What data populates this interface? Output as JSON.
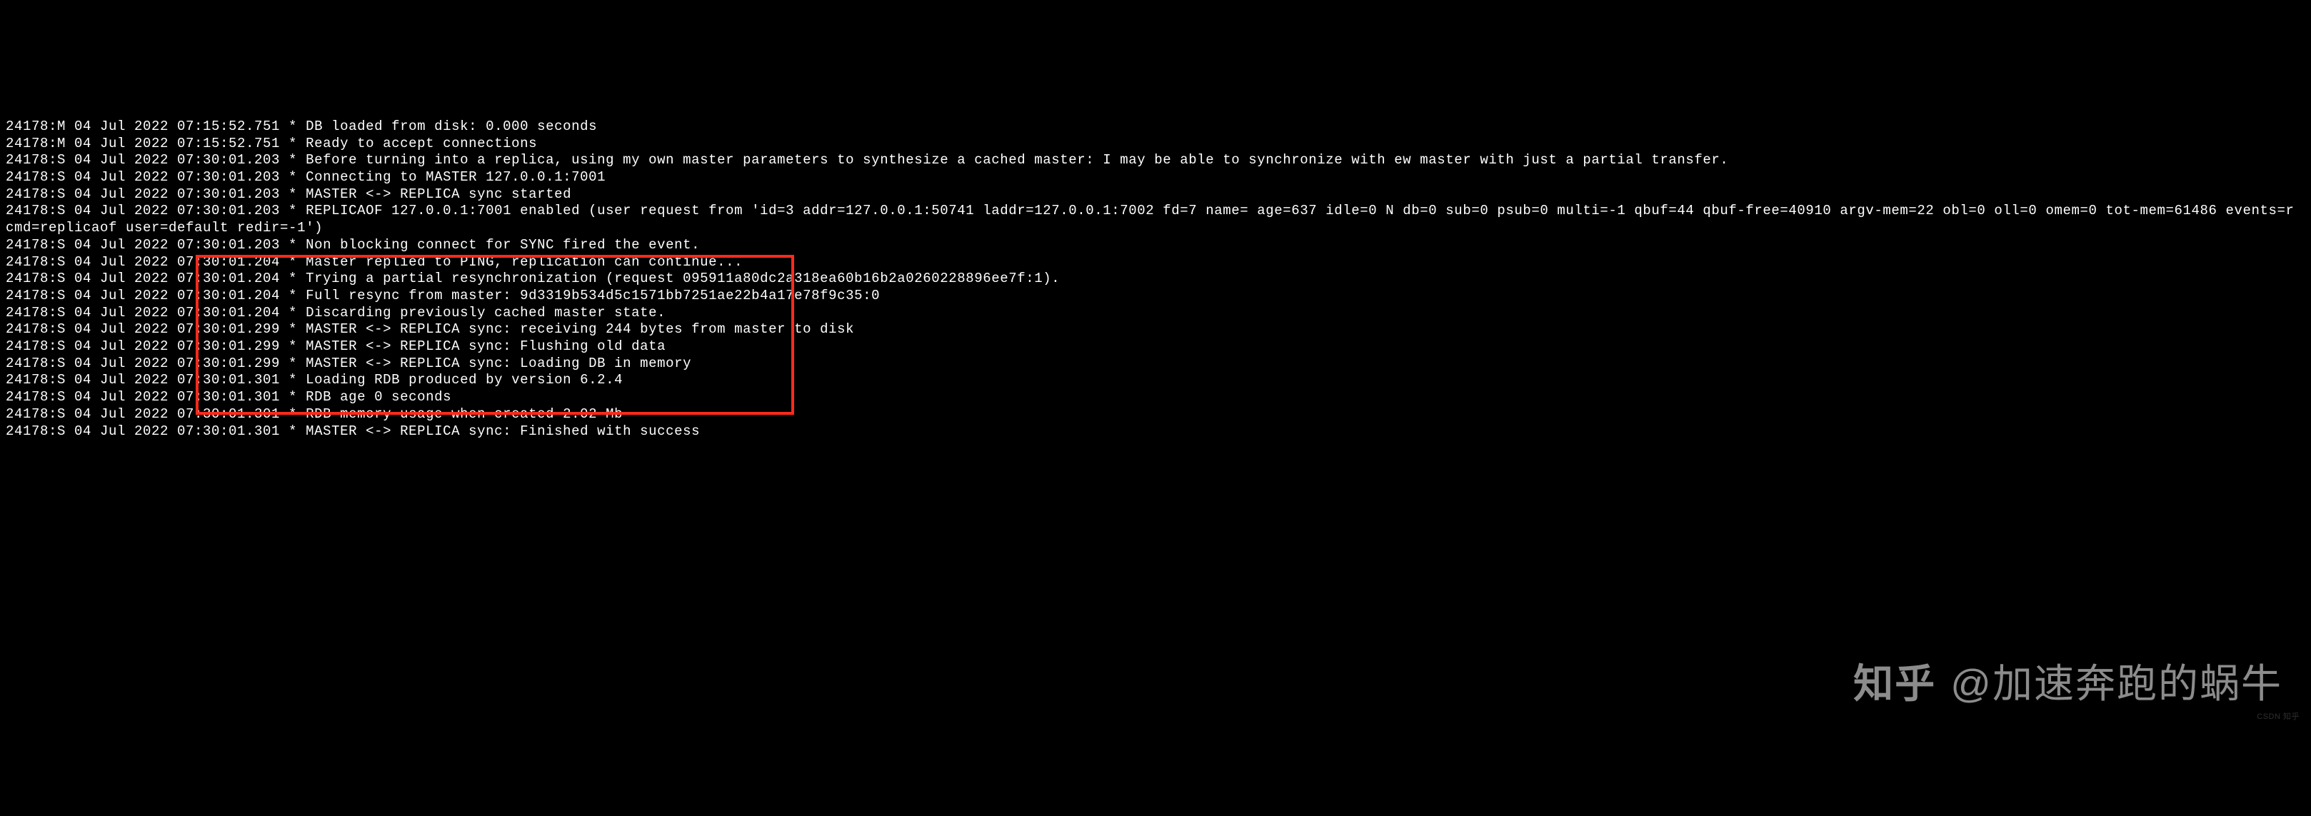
{
  "lines": [
    "24178:M 04 Jul 2022 07:15:52.751 * DB loaded from disk: 0.000 seconds",
    "24178:M 04 Jul 2022 07:15:52.751 * Ready to accept connections",
    "24178:S 04 Jul 2022 07:30:01.203 * Before turning into a replica, using my own master parameters to synthesize a cached master: I may be able to synchronize with ew master with just a partial transfer.",
    "24178:S 04 Jul 2022 07:30:01.203 * Connecting to MASTER 127.0.0.1:7001",
    "24178:S 04 Jul 2022 07:30:01.203 * MASTER <-> REPLICA sync started",
    "24178:S 04 Jul 2022 07:30:01.203 * REPLICAOF 127.0.0.1:7001 enabled (user request from 'id=3 addr=127.0.0.1:50741 laddr=127.0.0.1:7002 fd=7 name= age=637 idle=0 N db=0 sub=0 psub=0 multi=-1 qbuf=44 qbuf-free=40910 argv-mem=22 obl=0 oll=0 omem=0 tot-mem=61486 events=r cmd=replicaof user=default redir=-1')",
    "24178:S 04 Jul 2022 07:30:01.203 * Non blocking connect for SYNC fired the event.",
    "24178:S 04 Jul 2022 07:30:01.204 * Master replied to PING, replication can continue...",
    "24178:S 04 Jul 2022 07:30:01.204 * Trying a partial resynchronization (request 095911a80dc2a318ea60b16b2a0260228896ee7f:1).",
    "24178:S 04 Jul 2022 07:30:01.204 * Full resync from master: 9d3319b534d5c1571bb7251ae22b4a17e78f9c35:0",
    "24178:S 04 Jul 2022 07:30:01.204 * Discarding previously cached master state.",
    "24178:S 04 Jul 2022 07:30:01.299 * MASTER <-> REPLICA sync: receiving 244 bytes from master to disk",
    "24178:S 04 Jul 2022 07:30:01.299 * MASTER <-> REPLICA sync: Flushing old data",
    "24178:S 04 Jul 2022 07:30:01.299 * MASTER <-> REPLICA sync: Loading DB in memory",
    "24178:S 04 Jul 2022 07:30:01.301 * Loading RDB produced by version 6.2.4",
    "24178:S 04 Jul 2022 07:30:01.301 * RDB age 0 seconds",
    "24178:S 04 Jul 2022 07:30:01.301 * RDB memory usage when created 2.02 Mb",
    "24178:S 04 Jul 2022 07:30:01.301 * MASTER <-> REPLICA sync: Finished with success"
  ],
  "watermark": {
    "brand": "知乎",
    "author": "@加速奔跑的蜗牛"
  },
  "tiny_watermark": "CSDN 知乎"
}
